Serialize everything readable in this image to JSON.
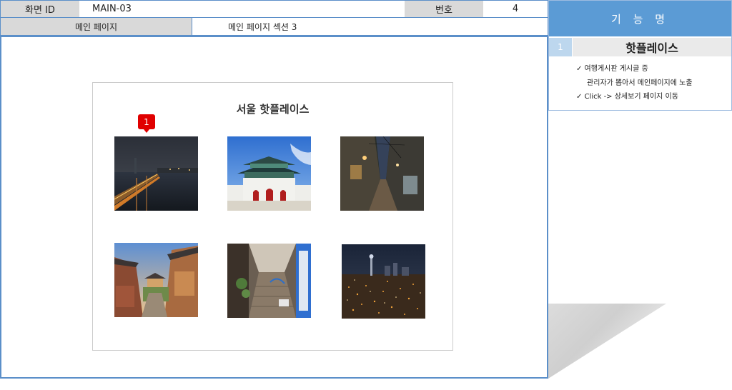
{
  "header": {
    "screen_id_label": "화면 ID",
    "screen_id_value": "MAIN-03",
    "number_label": "번호",
    "number_value": "4",
    "page_label": "메인 페이지",
    "page_value": "메인 페이지 섹션 3"
  },
  "spec": {
    "title": "기 능 명",
    "item_number": "1",
    "item_title": "핫플레이스",
    "lines": [
      "✓  여행게시판 게시글 중",
      "관리자가 뽑아서 메인페이지에 노출",
      "✓  Click -> 상세보기 페이지 이동"
    ]
  },
  "main": {
    "card_title": "서울 핫플레이스",
    "badge": "1",
    "photos": [
      {
        "name": "han-river-bridge-night-photo"
      },
      {
        "name": "gwanghwamun-gate-photo"
      },
      {
        "name": "alley-night-photo"
      },
      {
        "name": "bukchon-hanok-village-photo"
      },
      {
        "name": "narrow-alley-stairs-photo"
      },
      {
        "name": "seoul-city-night-view-photo"
      }
    ]
  }
}
